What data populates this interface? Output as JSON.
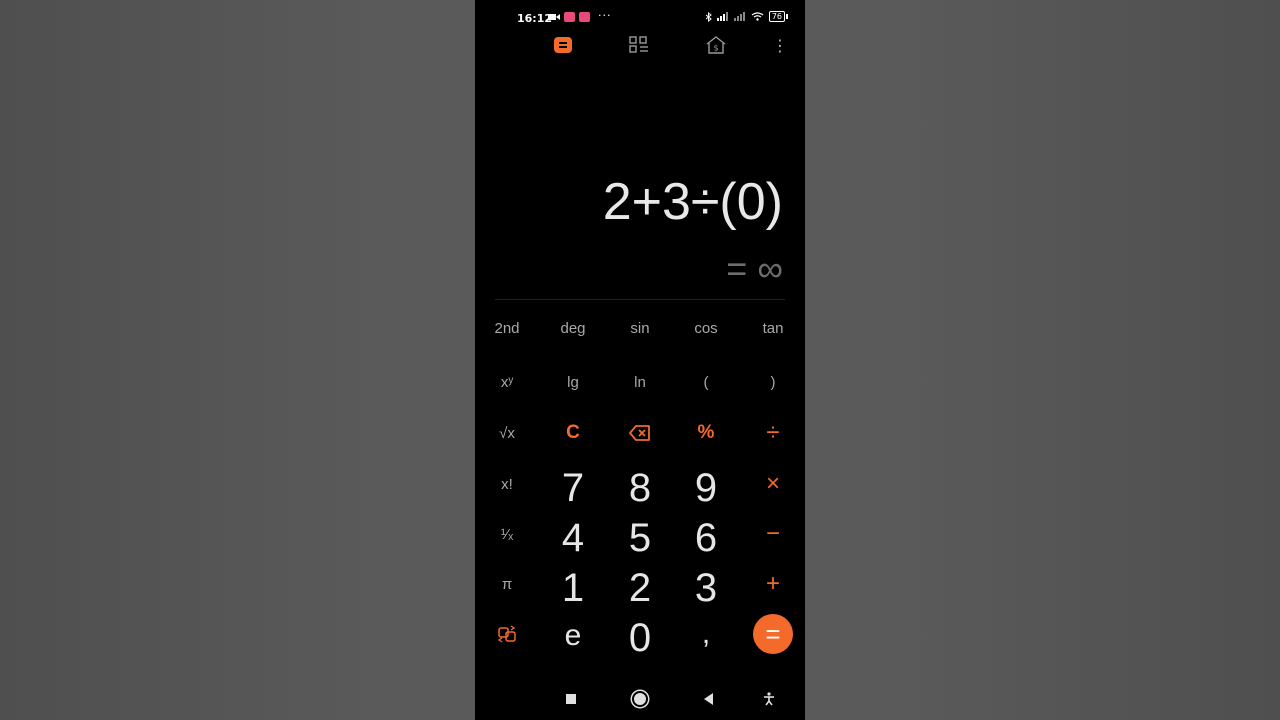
{
  "status_bar": {
    "time": "16:12",
    "overflow": "···",
    "battery": "76",
    "icons": [
      "video-icon",
      "app-notification-icon",
      "app-notification-icon",
      "bluetooth-icon",
      "signal-icon",
      "signal-icon",
      "wifi-icon",
      "battery-icon"
    ]
  },
  "toolbar": {
    "tabs": [
      {
        "icon": "calculator-icon",
        "active": true
      },
      {
        "icon": "converter-grid-icon",
        "active": false
      },
      {
        "icon": "currency-house-icon",
        "active": false
      }
    ],
    "more": "⋮"
  },
  "display": {
    "expression": "2+3÷(0)",
    "result": "= ∞"
  },
  "keypad": {
    "row1": [
      "2nd",
      "deg",
      "sin",
      "cos",
      "tan"
    ],
    "row2": [
      "xʸ",
      "lg",
      "ln",
      "(",
      ")"
    ],
    "row3": [
      "√x",
      "C",
      "backspace",
      "%",
      "÷"
    ],
    "row4": [
      "x!",
      "7",
      "8",
      "9",
      "×"
    ],
    "row5": [
      "¹⁄ₓ",
      "4",
      "5",
      "6",
      "−"
    ],
    "row6": [
      "π",
      "1",
      "2",
      "3",
      "+"
    ],
    "row7": [
      "swap",
      "e",
      "0",
      ",",
      "="
    ]
  },
  "colors": {
    "accent": "#f36a2a",
    "background": "#000000",
    "number_text": "#e6e6e6",
    "scientific_text": "#a9a9a9",
    "result_text": "#6d6d6d"
  },
  "nav_bar": {
    "icons": [
      "recents-icon",
      "home-icon",
      "back-icon",
      "accessibility-icon"
    ]
  }
}
